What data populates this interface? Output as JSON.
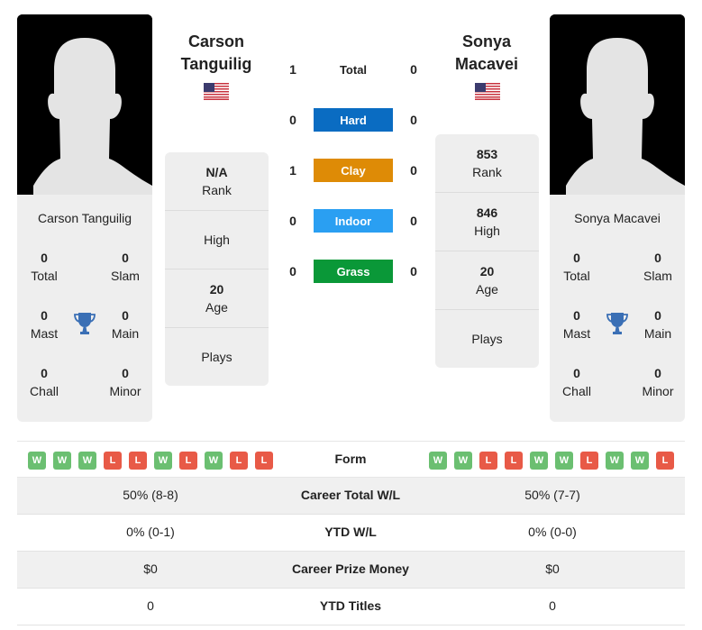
{
  "player1": {
    "name": "Carson Tanguilig",
    "header_first": "Carson",
    "header_last": "Tanguilig",
    "flag": "us-flag",
    "titles": {
      "total": {
        "value": "0",
        "label": "Total"
      },
      "slam": {
        "value": "0",
        "label": "Slam"
      },
      "mast": {
        "value": "0",
        "label": "Mast"
      },
      "main": {
        "value": "0",
        "label": "Main"
      },
      "chall": {
        "value": "0",
        "label": "Chall"
      },
      "minor": {
        "value": "0",
        "label": "Minor"
      }
    },
    "info": {
      "rank": {
        "value": "N/A",
        "label": "Rank"
      },
      "high": {
        "value": "",
        "label": "High"
      },
      "age": {
        "value": "20",
        "label": "Age"
      },
      "plays": {
        "value": "",
        "label": "Plays"
      }
    },
    "form": [
      "W",
      "W",
      "W",
      "L",
      "L",
      "W",
      "L",
      "W",
      "L",
      "L"
    ]
  },
  "player2": {
    "name": "Sonya Macavei",
    "header_first": "Sonya",
    "header_last": "Macavei",
    "flag": "us-flag",
    "titles": {
      "total": {
        "value": "0",
        "label": "Total"
      },
      "slam": {
        "value": "0",
        "label": "Slam"
      },
      "mast": {
        "value": "0",
        "label": "Mast"
      },
      "main": {
        "value": "0",
        "label": "Main"
      },
      "chall": {
        "value": "0",
        "label": "Chall"
      },
      "minor": {
        "value": "0",
        "label": "Minor"
      }
    },
    "info": {
      "rank": {
        "value": "853",
        "label": "Rank"
      },
      "high": {
        "value": "846",
        "label": "High"
      },
      "age": {
        "value": "20",
        "label": "Age"
      },
      "plays": {
        "value": "",
        "label": "Plays"
      }
    },
    "form": [
      "W",
      "W",
      "L",
      "L",
      "W",
      "W",
      "L",
      "W",
      "W",
      "L"
    ]
  },
  "h2h": [
    {
      "label": "Total",
      "p1": "1",
      "p2": "0",
      "color": ""
    },
    {
      "label": "Hard",
      "p1": "0",
      "p2": "0",
      "color": "#0a6cc2"
    },
    {
      "label": "Clay",
      "p1": "1",
      "p2": "0",
      "color": "#de8b06"
    },
    {
      "label": "Indoor",
      "p1": "0",
      "p2": "0",
      "color": "#2a9ff2"
    },
    {
      "label": "Grass",
      "p1": "0",
      "p2": "0",
      "color": "#0a9838"
    }
  ],
  "form_label": "Form",
  "stats": [
    {
      "label": "Career Total W/L",
      "p1": "50% (8-8)",
      "p2": "50% (7-7)"
    },
    {
      "label": "YTD W/L",
      "p1": "0% (0-1)",
      "p2": "0% (0-0)"
    },
    {
      "label": "Career Prize Money",
      "p1": "$0",
      "p2": "$0"
    },
    {
      "label": "YTD Titles",
      "p1": "0",
      "p2": "0"
    }
  ],
  "colors": {
    "win": "#6bbf71",
    "loss": "#e85a47",
    "trophy": "#3a6fb5"
  }
}
